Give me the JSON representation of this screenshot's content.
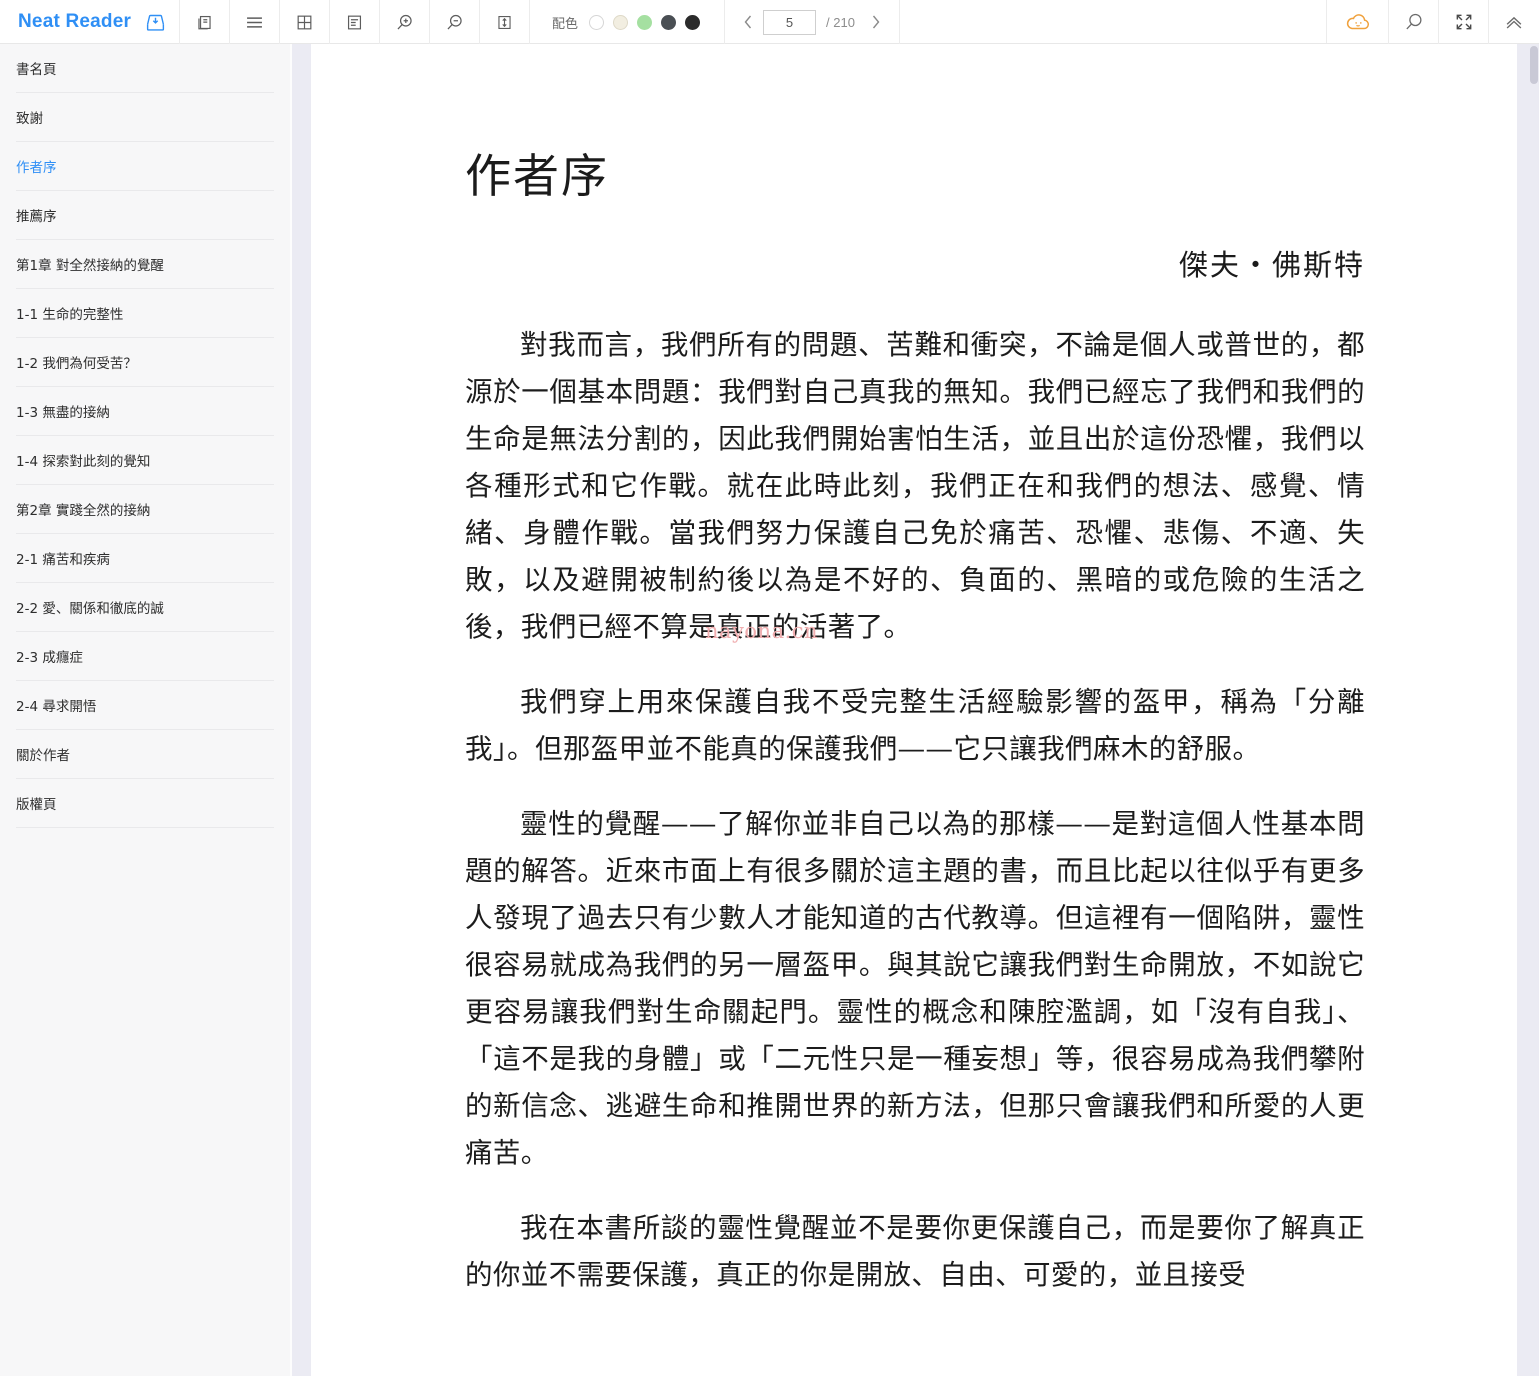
{
  "app": {
    "brand": "Neat Reader",
    "brand_color": "#2f8ff5",
    "save_icon": "save-to-library-icon"
  },
  "toolbar": {
    "icons": [
      {
        "name": "book-pages-icon",
        "title": "分欄"
      },
      {
        "name": "menu-list-icon",
        "title": "目錄"
      },
      {
        "name": "grid-layout-icon",
        "title": "版面"
      },
      {
        "name": "text-layout-icon",
        "title": "排版"
      },
      {
        "name": "zoom-in-icon",
        "title": "放大"
      },
      {
        "name": "zoom-out-icon",
        "title": "縮小"
      },
      {
        "name": "line-height-icon",
        "title": "行距"
      }
    ],
    "scheme": {
      "label": "配色",
      "swatches": [
        {
          "name": "swatch-white",
          "color": "#ffffff",
          "border": "#d6d6d6",
          "selected": false
        },
        {
          "name": "swatch-sepia",
          "color": "#f2eee1",
          "border": "#ded9c8",
          "selected": false
        },
        {
          "name": "swatch-green",
          "color": "#a5e0a1",
          "border": "#a5e0a1",
          "selected": false
        },
        {
          "name": "swatch-dark-gray",
          "color": "#4a4f54",
          "border": "#4a4f54",
          "selected": false
        },
        {
          "name": "swatch-black",
          "color": "#2b2b2b",
          "border": "#2b2b2b",
          "selected": false
        }
      ]
    },
    "pager": {
      "prev_label": "‹",
      "next_label": "›",
      "current_page": "5",
      "total_label": "/ 210",
      "total_pages": 210
    },
    "right_icons": [
      {
        "name": "cloud-sync-icon",
        "title": "雲端",
        "color": "#f0a13c"
      },
      {
        "name": "search-icon",
        "title": "搜尋",
        "color": "#6b6b6b"
      },
      {
        "name": "fullscreen-icon",
        "title": "全螢幕",
        "color": "#4a4a4a"
      },
      {
        "name": "collapse-up-icon",
        "title": "收起",
        "color": "#6b6b6b"
      }
    ]
  },
  "sidebar": {
    "items": [
      {
        "label": "書名頁",
        "active": false
      },
      {
        "label": "致謝",
        "active": false
      },
      {
        "label": "作者序",
        "active": true
      },
      {
        "label": "推薦序",
        "active": false
      },
      {
        "label": "第1章 對全然接納的覺醒",
        "active": false
      },
      {
        "label": "1-1 生命的完整性",
        "active": false
      },
      {
        "label": "1-2 我們為何受苦？",
        "active": false
      },
      {
        "label": "1-3 無盡的接納",
        "active": false
      },
      {
        "label": "1-4 探索對此刻的覺知",
        "active": false
      },
      {
        "label": "第2章 實踐全然的接納",
        "active": false
      },
      {
        "label": "2-1 痛苦和疾病",
        "active": false
      },
      {
        "label": "2-2 愛、關係和徹底的誠",
        "active": false
      },
      {
        "label": "2-3 成癮症",
        "active": false
      },
      {
        "label": "2-4 尋求開悟",
        "active": false
      },
      {
        "label": "關於作者",
        "active": false
      },
      {
        "label": "版權頁",
        "active": false
      }
    ]
  },
  "document": {
    "title": "作者序",
    "author": "傑夫・佛斯特",
    "watermark": "nayona.cn",
    "paragraphs": [
      "對我而言，我們所有的問題、苦難和衝突，不論是個人或普世的，都源於一個基本問題：我們對自己真我的無知。我們已經忘了我們和我們的生命是無法分割的，因此我們開始害怕生活，並且出於這份恐懼，我們以各種形式和它作戰。就在此時此刻，我們正在和我們的想法、感覺、情緒、身體作戰。當我們努力保護自己免於痛苦、恐懼、悲傷、不適、失敗，以及避開被制約後以為是不好的、負面的、黑暗的或危險的生活之後，我們已經不算是真正的活著了。",
      "我們穿上用來保護自我不受完整生活經驗影響的盔甲，稱為「分離我」。但那盔甲並不能真的保護我們——它只讓我們麻木的舒服。",
      "靈性的覺醒——了解你並非自己以為的那樣——是對這個人性基本問題的解答。近來市面上有很多關於這主題的書，而且比起以往似乎有更多人發現了過去只有少數人才能知道的古代教導。但這裡有一個陷阱，靈性很容易就成為我們的另一層盔甲。與其說它讓我們對生命開放，不如說它更容易讓我們對生命關起門。靈性的概念和陳腔濫調，如「沒有自我」、「這不是我的身體」或「二元性只是一種妄想」等，很容易成為我們攀附的新信念、逃避生命和推開世界的新方法，但那只會讓我們和所愛的人更痛苦。",
      "我在本書所談的靈性覺醒並不是要你更保護自己，而是要你了解真正的你並不需要保護，真正的你是開放、自由、可愛的，並且接受"
    ]
  }
}
